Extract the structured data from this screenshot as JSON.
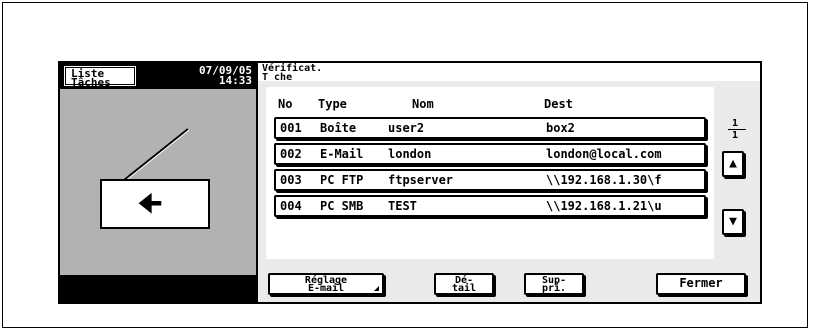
{
  "left_panel": {
    "job_list_button": {
      "line1": "Liste",
      "line2": "Tâches"
    },
    "date": "07/09/05",
    "time": "14:33",
    "back_icon": "left-arrow"
  },
  "header": {
    "title_line1": "Vérificat.",
    "title_line2": "T che"
  },
  "table": {
    "columns": [
      "No",
      "Type",
      "Nom",
      "Dest"
    ],
    "rows": [
      {
        "no": "001",
        "type": "Boîte",
        "nom": "user2",
        "dest": "box2"
      },
      {
        "no": "002",
        "type": "E-Mail",
        "nom": "london",
        "dest": "london@local.com"
      },
      {
        "no": "003",
        "type": "PC  FTP",
        "nom": "ftpserver",
        "dest": "\\\\192.168.1.30\\f"
      },
      {
        "no": "004",
        "type": "PC  SMB",
        "nom": "TEST",
        "dest": "\\\\192.168.1.21\\u"
      }
    ]
  },
  "pager": {
    "current": "1",
    "total": "1",
    "up_icon": "up-arrow",
    "down_icon": "down-arrow"
  },
  "footer": {
    "reglage_line1": "Réglage",
    "reglage_line2": "E-mail",
    "detail_line1": "Dé-",
    "detail_line2": "tail",
    "supprimer_line1": "Sup-",
    "supprimer_line2": "pri.",
    "close_label": "Fermer"
  }
}
